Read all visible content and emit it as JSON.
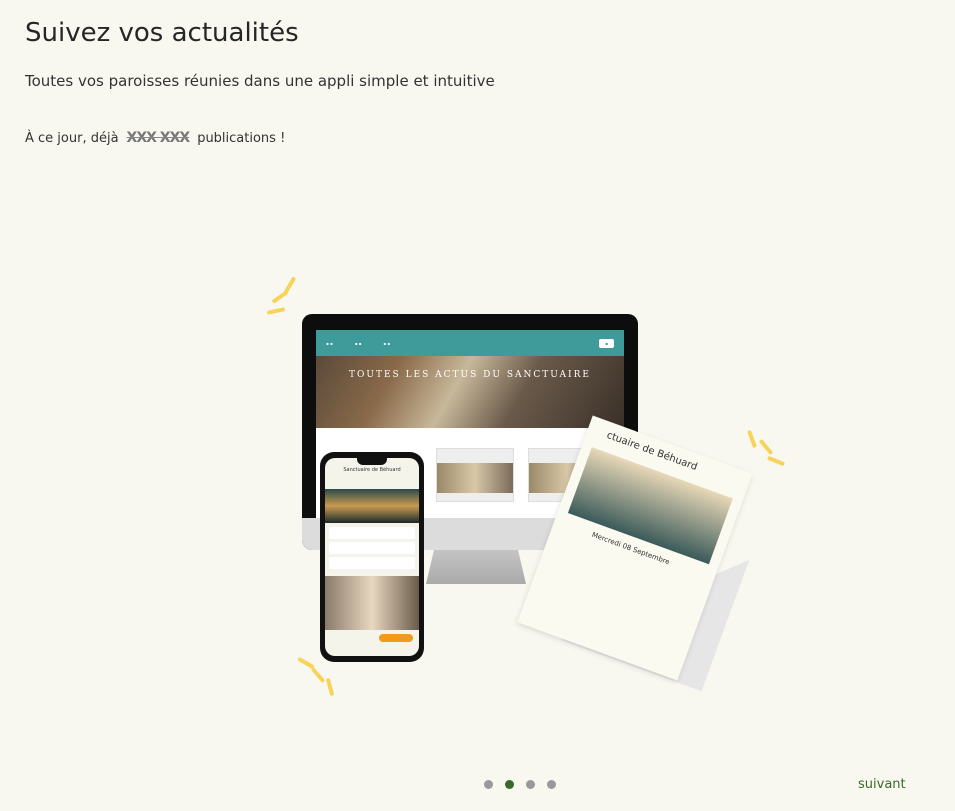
{
  "header": {
    "title": "Suivez vos actualités",
    "subtitle": "Toutes vos paroisses réunies dans une appli simple et intuitive"
  },
  "counter": {
    "prefix": "À ce jour, déjà",
    "value": "XXX XXX",
    "suffix": "publications !"
  },
  "illustration": {
    "site_hero_title": "TOUTES LES ACTUS DU SANCTUAIRE",
    "phone_title": "Sanctuaire de Béhuard",
    "paper_title": "ctuaire de Béhuard",
    "paper_date": "Mercredi 08 Septembre"
  },
  "colors": {
    "background": "#f8f8f0",
    "accent": "#3a6a2a",
    "spark": "#f7d35a",
    "teal": "#3f9a9a"
  },
  "pagination": {
    "count": 4,
    "active_index": 1
  },
  "footer": {
    "next_label": "suivant"
  }
}
